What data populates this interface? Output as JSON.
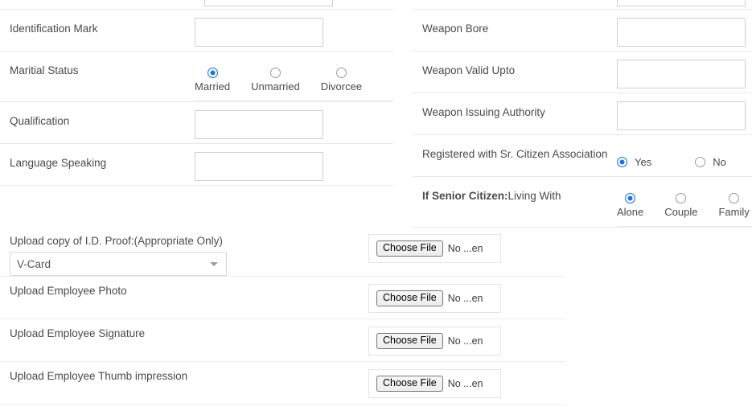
{
  "left_column": {
    "top_partial_row": {
      "name": "partial-input-above"
    },
    "fields": [
      {
        "label": "Identification Mark",
        "control": "text"
      },
      {
        "label": "Maritial Status",
        "control": "radio-stack",
        "options": [
          {
            "label": "Married",
            "selected": true
          },
          {
            "label": "Unmarried",
            "selected": false
          },
          {
            "label": "Divorcee",
            "selected": false
          }
        ]
      },
      {
        "label": "Qualification",
        "control": "text"
      },
      {
        "label": "Language Speaking",
        "control": "text"
      }
    ]
  },
  "right_column": {
    "top_partial_row": {
      "name": "partial-input-above"
    },
    "fields": [
      {
        "label": "Weapon Bore",
        "control": "text"
      },
      {
        "label": "Weapon Valid Upto",
        "control": "text"
      },
      {
        "label": "Weapon Issuing Authority",
        "control": "text"
      },
      {
        "label": "Registered with Sr. Citizen Association",
        "control": "radio-inline",
        "options": [
          {
            "label": "Yes",
            "selected": true
          },
          {
            "label": "No",
            "selected": false
          }
        ]
      },
      {
        "label_bold": "If Senior Citizen:",
        "label": "Living With",
        "control": "radio-stack",
        "options": [
          {
            "label": "Alone",
            "selected": true
          },
          {
            "label": "Couple",
            "selected": false
          },
          {
            "label": "Family",
            "selected": false
          }
        ]
      }
    ]
  },
  "uploads": {
    "rows": [
      {
        "label": "Upload copy of I.D. Proof:(Appropriate Only)",
        "select_value": "V-Card",
        "file_button": "Choose File",
        "file_status": "No ...en"
      },
      {
        "label": "Upload Employee Photo",
        "file_button": "Choose File",
        "file_status": "No ...en"
      },
      {
        "label": "Upload Employee Signature",
        "file_button": "Choose File",
        "file_status": "No ...en"
      },
      {
        "label": "Upload Employee Thumb impression",
        "file_button": "Choose File",
        "file_status": "No ...en"
      }
    ]
  },
  "colors": {
    "accent": "#1a73e8",
    "label_text": "#4a4a4a",
    "divider": "#e9e9e9",
    "input_border": "#cfcfcf"
  }
}
